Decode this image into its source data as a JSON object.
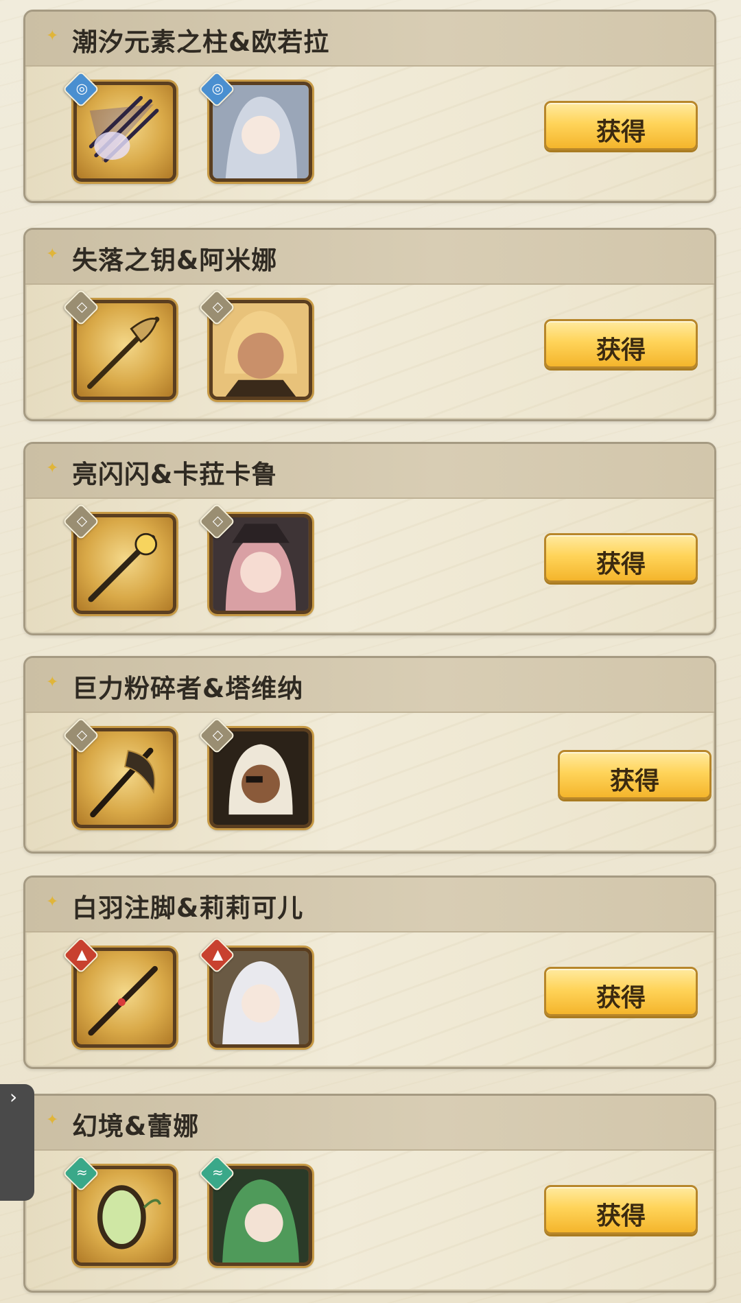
{
  "cards": [
    {
      "title": "潮汐元素之柱&欧若拉",
      "element": "water",
      "element_color": "#4a8fd0",
      "element_icon": "swirl-icon",
      "button_label": "获得"
    },
    {
      "title": "失落之钥&阿米娜",
      "element": "neutral",
      "element_color": "#9a8e72",
      "element_icon": "rune-icon",
      "button_label": "获得"
    },
    {
      "title": "亮闪闪&卡菈卡鲁",
      "element": "neutral",
      "element_color": "#9a8e72",
      "element_icon": "rune-icon",
      "button_label": "获得"
    },
    {
      "title": "巨力粉碎者&塔维纳",
      "element": "neutral",
      "element_color": "#9a8e72",
      "element_icon": "rune-icon",
      "button_label": "获得"
    },
    {
      "title": "白羽注脚&莉莉可儿",
      "element": "fire",
      "element_color": "#c8412f",
      "element_icon": "flame-icon",
      "button_label": "获得"
    },
    {
      "title": "幻境&蕾娜",
      "element": "wind",
      "element_color": "#3aa889",
      "element_icon": "wind-icon",
      "button_label": "获得"
    }
  ],
  "accent_gold": "#f4b52c",
  "side_tab_icon": "chevron-icon"
}
